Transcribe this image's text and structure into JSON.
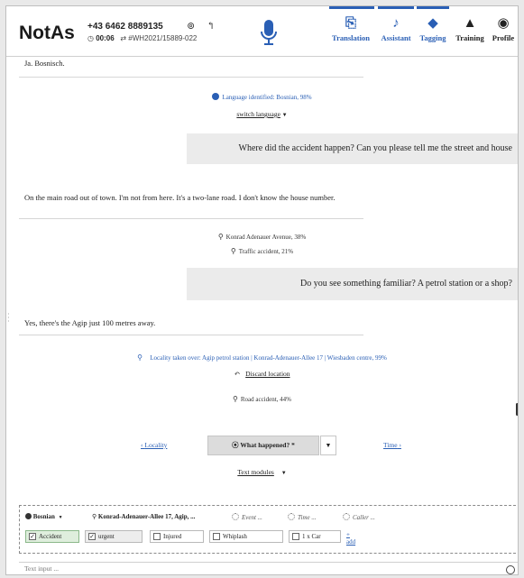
{
  "header": {
    "app_name": "NotAs",
    "phone": "+43 6462 8889135",
    "timer": "00:06",
    "case_id": "#WH2021/15889-022",
    "nav": [
      {
        "label": "Translation",
        "icon": "translation-icon"
      },
      {
        "label": "Assistant",
        "icon": "assistant-icon"
      },
      {
        "label": "Tagging",
        "icon": "tag-icon"
      },
      {
        "label": "Training",
        "icon": "training-icon"
      },
      {
        "label": "Profile",
        "icon": "profile-icon"
      }
    ]
  },
  "conversation": {
    "cut_text": "Ja. Bosnisch.",
    "language_identified": "Language identified: Bosnian, 98%",
    "switch_language": "switch language",
    "msg_q1": "Where did the accident happen? Can you please tell me the street and house",
    "msg_a1": "On the main road out of town. I'm not from here. It's a two-lane road. I don't know the house number.",
    "suggestion_1": "Konrad Adenauer Avenue, 38%",
    "suggestion_2": "Traffic accident, 21%",
    "msg_q2": "Do you see something familiar? A petrol station or a shop?",
    "msg_a2": "Yes, there's the Agip just 100 metres away.",
    "locality_taken": "Locality taken over: Agip petrol station | Konrad-Adenauer-Allee 17 | Wiesbaden centre, 99%",
    "discard_location": "Discard location",
    "suggestion_3": "Road accident, 44%"
  },
  "step_nav": {
    "prev": "Locality",
    "current": "What happened? *",
    "next": "Time",
    "text_modules": "Text modules"
  },
  "filters": {
    "language": "Bosnian",
    "address": "Konrad-Adenauer-Allee 17, Agip, ...",
    "event": "Event ...",
    "time": "Time ...",
    "caller": "Caller ...",
    "chips": [
      {
        "label": "Accident",
        "checked": true
      },
      {
        "label": "urgent",
        "checked": true
      },
      {
        "label": "Injured",
        "checked": false
      },
      {
        "label": "Whiplash",
        "checked": false
      },
      {
        "label": "1 x Car",
        "checked": false
      }
    ],
    "add": "+ add"
  },
  "text_input": {
    "placeholder": "Text input ..."
  },
  "colors": {
    "accent": "#2a5fb5",
    "bubble_bg": "#ebebeb",
    "chip_on": "#dfeedd"
  }
}
